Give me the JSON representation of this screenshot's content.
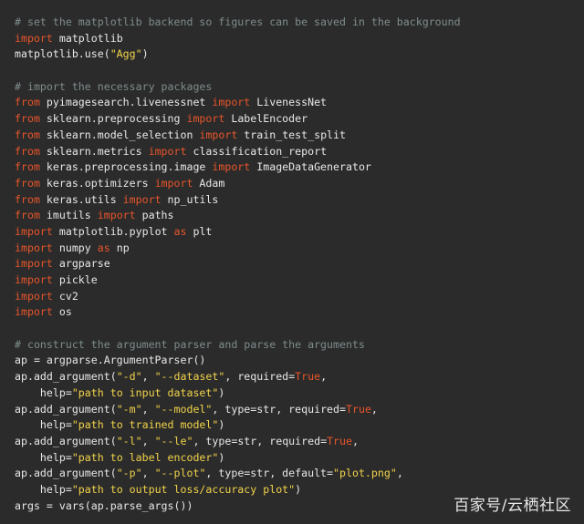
{
  "colors": {
    "background": "#2b2b2b",
    "comment": "#7f8c8d",
    "keyword": "#e8552b",
    "string": "#f2d34a",
    "text": "#e8e8e8"
  },
  "watermark": "百家号/云栖社区",
  "code_lines": [
    [
      {
        "t": "comment",
        "v": "# set the matplotlib backend so figures can be saved in the background"
      }
    ],
    [
      {
        "t": "kw",
        "v": "import"
      },
      {
        "t": "plain",
        "v": " matplotlib"
      }
    ],
    [
      {
        "t": "plain",
        "v": "matplotlib.use("
      },
      {
        "t": "str",
        "v": "\"Agg\""
      },
      {
        "t": "plain",
        "v": ")"
      }
    ],
    [
      {
        "t": "plain",
        "v": ""
      }
    ],
    [
      {
        "t": "comment",
        "v": "# import the necessary packages"
      }
    ],
    [
      {
        "t": "kw",
        "v": "from"
      },
      {
        "t": "plain",
        "v": " pyimagesearch.livenessnet "
      },
      {
        "t": "kw",
        "v": "import"
      },
      {
        "t": "plain",
        "v": " LivenessNet"
      }
    ],
    [
      {
        "t": "kw",
        "v": "from"
      },
      {
        "t": "plain",
        "v": " sklearn.preprocessing "
      },
      {
        "t": "kw",
        "v": "import"
      },
      {
        "t": "plain",
        "v": " LabelEncoder"
      }
    ],
    [
      {
        "t": "kw",
        "v": "from"
      },
      {
        "t": "plain",
        "v": " sklearn.model_selection "
      },
      {
        "t": "kw",
        "v": "import"
      },
      {
        "t": "plain",
        "v": " train_test_split"
      }
    ],
    [
      {
        "t": "kw",
        "v": "from"
      },
      {
        "t": "plain",
        "v": " sklearn.metrics "
      },
      {
        "t": "kw",
        "v": "import"
      },
      {
        "t": "plain",
        "v": " classification_report"
      }
    ],
    [
      {
        "t": "kw",
        "v": "from"
      },
      {
        "t": "plain",
        "v": " keras.preprocessing.image "
      },
      {
        "t": "kw",
        "v": "import"
      },
      {
        "t": "plain",
        "v": " ImageDataGenerator"
      }
    ],
    [
      {
        "t": "kw",
        "v": "from"
      },
      {
        "t": "plain",
        "v": " keras.optimizers "
      },
      {
        "t": "kw",
        "v": "import"
      },
      {
        "t": "plain",
        "v": " Adam"
      }
    ],
    [
      {
        "t": "kw",
        "v": "from"
      },
      {
        "t": "plain",
        "v": " keras.utils "
      },
      {
        "t": "kw",
        "v": "import"
      },
      {
        "t": "plain",
        "v": " np_utils"
      }
    ],
    [
      {
        "t": "kw",
        "v": "from"
      },
      {
        "t": "plain",
        "v": " imutils "
      },
      {
        "t": "kw",
        "v": "import"
      },
      {
        "t": "plain",
        "v": " paths"
      }
    ],
    [
      {
        "t": "kw",
        "v": "import"
      },
      {
        "t": "plain",
        "v": " matplotlib.pyplot "
      },
      {
        "t": "kw",
        "v": "as"
      },
      {
        "t": "plain",
        "v": " plt"
      }
    ],
    [
      {
        "t": "kw",
        "v": "import"
      },
      {
        "t": "plain",
        "v": " numpy "
      },
      {
        "t": "kw",
        "v": "as"
      },
      {
        "t": "plain",
        "v": " np"
      }
    ],
    [
      {
        "t": "kw",
        "v": "import"
      },
      {
        "t": "plain",
        "v": " argparse"
      }
    ],
    [
      {
        "t": "kw",
        "v": "import"
      },
      {
        "t": "plain",
        "v": " pickle"
      }
    ],
    [
      {
        "t": "kw",
        "v": "import"
      },
      {
        "t": "plain",
        "v": " cv2"
      }
    ],
    [
      {
        "t": "kw",
        "v": "import"
      },
      {
        "t": "plain",
        "v": " os"
      }
    ],
    [
      {
        "t": "plain",
        "v": ""
      }
    ],
    [
      {
        "t": "comment",
        "v": "# construct the argument parser and parse the arguments"
      }
    ],
    [
      {
        "t": "plain",
        "v": "ap = argparse.ArgumentParser()"
      }
    ],
    [
      {
        "t": "plain",
        "v": "ap.add_argument("
      },
      {
        "t": "str",
        "v": "\"-d\""
      },
      {
        "t": "plain",
        "v": ", "
      },
      {
        "t": "str",
        "v": "\"--dataset\""
      },
      {
        "t": "plain",
        "v": ", required="
      },
      {
        "t": "kw",
        "v": "True"
      },
      {
        "t": "plain",
        "v": ","
      }
    ],
    [
      {
        "t": "plain",
        "v": "    help="
      },
      {
        "t": "str",
        "v": "\"path to input dataset\""
      },
      {
        "t": "plain",
        "v": ")"
      }
    ],
    [
      {
        "t": "plain",
        "v": "ap.add_argument("
      },
      {
        "t": "str",
        "v": "\"-m\""
      },
      {
        "t": "plain",
        "v": ", "
      },
      {
        "t": "str",
        "v": "\"--model\""
      },
      {
        "t": "plain",
        "v": ", type=str, required="
      },
      {
        "t": "kw",
        "v": "True"
      },
      {
        "t": "plain",
        "v": ","
      }
    ],
    [
      {
        "t": "plain",
        "v": "    help="
      },
      {
        "t": "str",
        "v": "\"path to trained model\""
      },
      {
        "t": "plain",
        "v": ")"
      }
    ],
    [
      {
        "t": "plain",
        "v": "ap.add_argument("
      },
      {
        "t": "str",
        "v": "\"-l\""
      },
      {
        "t": "plain",
        "v": ", "
      },
      {
        "t": "str",
        "v": "\"--le\""
      },
      {
        "t": "plain",
        "v": ", type=str, required="
      },
      {
        "t": "kw",
        "v": "True"
      },
      {
        "t": "plain",
        "v": ","
      }
    ],
    [
      {
        "t": "plain",
        "v": "    help="
      },
      {
        "t": "str",
        "v": "\"path to label encoder\""
      },
      {
        "t": "plain",
        "v": ")"
      }
    ],
    [
      {
        "t": "plain",
        "v": "ap.add_argument("
      },
      {
        "t": "str",
        "v": "\"-p\""
      },
      {
        "t": "plain",
        "v": ", "
      },
      {
        "t": "str",
        "v": "\"--plot\""
      },
      {
        "t": "plain",
        "v": ", type=str, default="
      },
      {
        "t": "str",
        "v": "\"plot.png\""
      },
      {
        "t": "plain",
        "v": ","
      }
    ],
    [
      {
        "t": "plain",
        "v": "    help="
      },
      {
        "t": "str",
        "v": "\"path to output loss/accuracy plot\""
      },
      {
        "t": "plain",
        "v": ")"
      }
    ],
    [
      {
        "t": "plain",
        "v": "args = vars(ap.parse_args())"
      }
    ]
  ]
}
